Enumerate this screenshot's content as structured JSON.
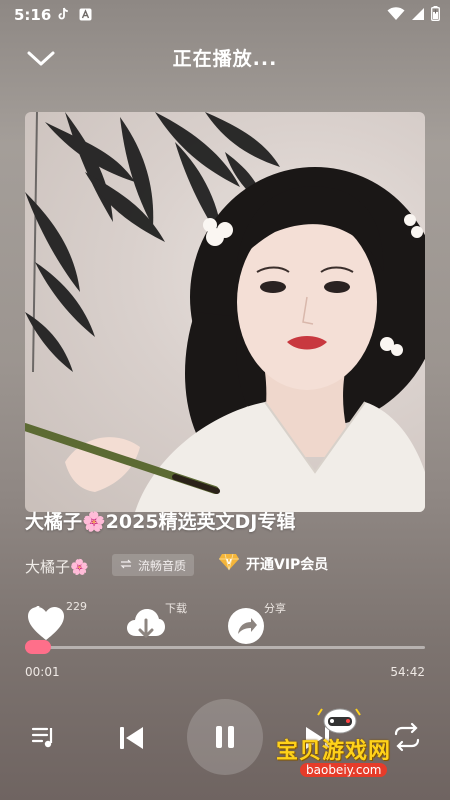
{
  "status_bar": {
    "time": "5:16"
  },
  "header": {
    "title": "正在播放..."
  },
  "song": {
    "title": "大橘子🌸2025精选英文DJ专辑",
    "artist": "大橘子🌸",
    "quality": "流畅音质",
    "vip_label": "开通VIP会员"
  },
  "actions": {
    "like_count": "229",
    "download_label": "下载",
    "share_label": "分享"
  },
  "progress": {
    "current": "00:01",
    "total": "54:42",
    "fraction": 0.0003
  },
  "watermark": {
    "text": "宝贝游戏网",
    "url": "baobeiy.com"
  },
  "colors": {
    "accent": "#ff6f8a",
    "vip": "#f4b53a"
  }
}
